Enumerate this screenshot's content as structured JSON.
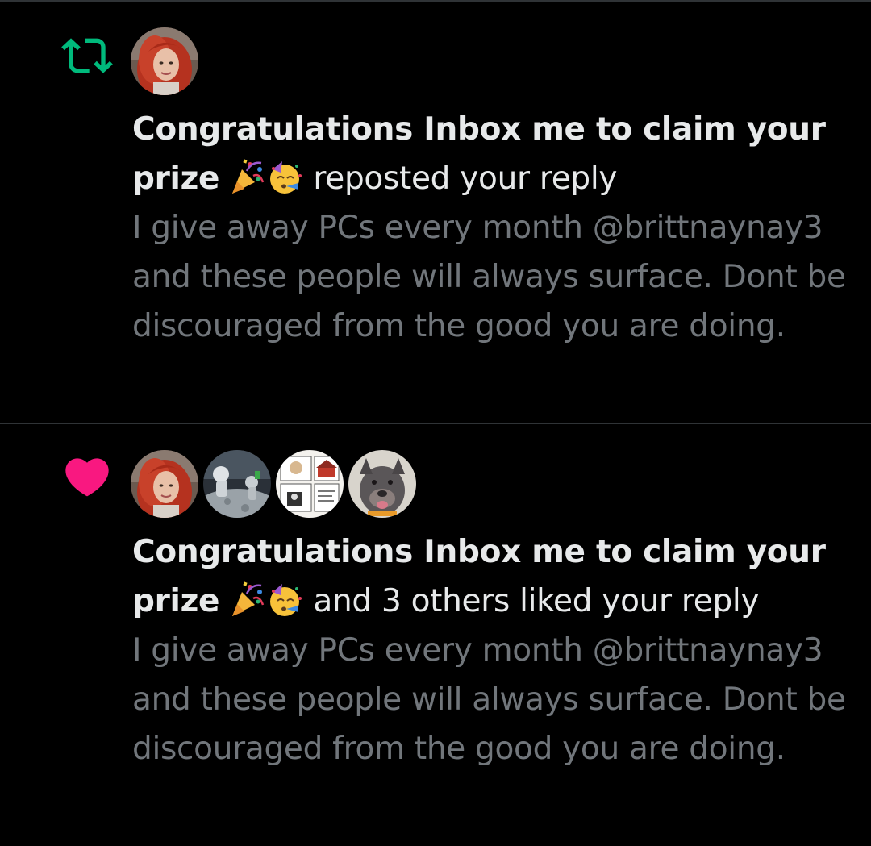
{
  "colors": {
    "background": "#000000",
    "primary_text": "#e7e9ea",
    "secondary_text": "#71767b",
    "divider": "#2f3336",
    "repost_green": "#00ba7c",
    "like_pink": "#f91880"
  },
  "notifications": [
    {
      "type": "repost",
      "icon": "repost-icon",
      "actor_name": "Congratulations Inbox me to claim your prize",
      "actor_emojis": [
        "party-popper-emoji",
        "partying-face-emoji"
      ],
      "action_text": "reposted your reply",
      "preview_text": "I give away PCs every month @brittnaynay3 and these people will always surface. Dont be discouraged from the good you are doing.",
      "avatars": [
        "red-haired-woman-avatar"
      ]
    },
    {
      "type": "like",
      "icon": "heart-icon",
      "actor_name": "Congratulations Inbox me to claim your prize",
      "actor_emojis": [
        "party-popper-emoji",
        "partying-face-emoji"
      ],
      "action_text": "and 3 others liked your reply",
      "preview_text": "I give away PCs every month @brittnaynay3 and these people will always surface. Dont be discouraged from the good you are doing.",
      "avatars": [
        "red-haired-woman-avatar",
        "astronaut-moon-avatar",
        "comic-strip-avatar",
        "dog-avatar"
      ]
    }
  ]
}
